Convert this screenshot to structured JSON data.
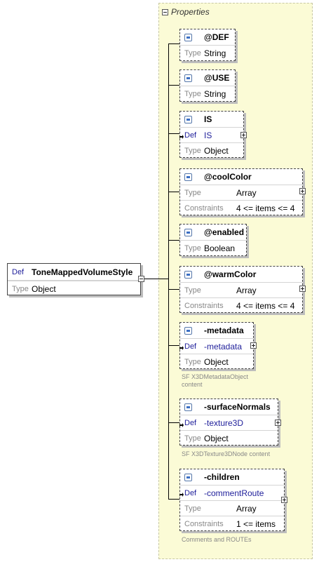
{
  "root": {
    "def_label": "Def",
    "name": "ToneMappedVolumeStyle",
    "type_label": "Type",
    "type": "Object"
  },
  "properties": {
    "title": "Properties",
    "items": [
      {
        "name": "@DEF",
        "rows": [
          {
            "label": "Type",
            "value": "String"
          }
        ]
      },
      {
        "name": "@USE",
        "rows": [
          {
            "label": "Type",
            "value": "String"
          }
        ]
      },
      {
        "name": "IS",
        "rows": [
          {
            "label": "Def",
            "value": "IS"
          },
          {
            "label": "Type",
            "value": "Object"
          }
        ]
      },
      {
        "name": "@coolColor",
        "rows": [
          {
            "label": "Type",
            "value": "Array"
          },
          {
            "label": "Constraints",
            "value": "4 <= items <= 4"
          }
        ]
      },
      {
        "name": "@enabled",
        "rows": [
          {
            "label": "Type",
            "value": "Boolean"
          }
        ]
      },
      {
        "name": "@warmColor",
        "rows": [
          {
            "label": "Type",
            "value": "Array"
          },
          {
            "label": "Constraints",
            "value": "4 <= items <= 4"
          }
        ]
      },
      {
        "name": "-metadata",
        "rows": [
          {
            "label": "Def",
            "value": "-metadata"
          },
          {
            "label": "Type",
            "value": "Object"
          }
        ],
        "note": [
          "SF X3DMetadataObject",
          "content"
        ]
      },
      {
        "name": "-surfaceNormals",
        "rows": [
          {
            "label": "Def",
            "value": "-texture3D"
          },
          {
            "label": "Type",
            "value": "Object"
          }
        ],
        "note": [
          "SF X3DTexture3DNode content"
        ]
      },
      {
        "name": "-children",
        "rows": [
          {
            "label": "Def",
            "value": "-commentRoute"
          },
          {
            "label": "Type",
            "value": "Array"
          },
          {
            "label": "Constraints",
            "value": "1 <= items"
          }
        ],
        "note": [
          "Comments and ROUTEs"
        ]
      }
    ]
  }
}
